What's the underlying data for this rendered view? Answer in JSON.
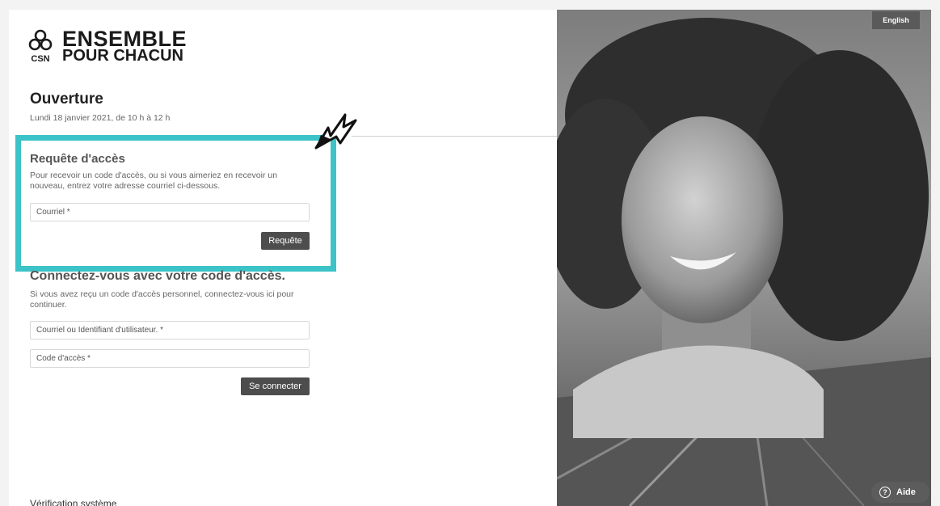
{
  "brand": {
    "logo_line1": "ENSEMBLE",
    "logo_line2": "POUR CHACUN",
    "logo_mark_text": "CSN"
  },
  "event": {
    "title": "Ouverture",
    "date": "Lundi 18 janvier 2021, de 10 h à 12 h"
  },
  "access_request": {
    "title": "Requête d'accès",
    "description": "Pour recevoir un code d'accès, ou si vous aimeriez en recevoir un nouveau, entrez votre adresse courriel ci-dessous.",
    "email_placeholder": "Courriel *",
    "submit_label": "Requête"
  },
  "login": {
    "title": "Connectez-vous avec votre code d'accès.",
    "description": "Si vous avez reçu un code d'accès personnel, connectez-vous ici pour continuer.",
    "user_placeholder": "Courriel ou Identifiant d'utilisateur. *",
    "code_placeholder": "Code d'accès *",
    "submit_label": "Se connecter"
  },
  "footer": {
    "partial_text": "Vérification système"
  },
  "header_right": {
    "language_label": "English"
  },
  "help": {
    "icon_glyph": "?",
    "label": "Aide"
  },
  "colors": {
    "highlight": "#3cc3c7",
    "button_bg": "#4d4d4d"
  }
}
